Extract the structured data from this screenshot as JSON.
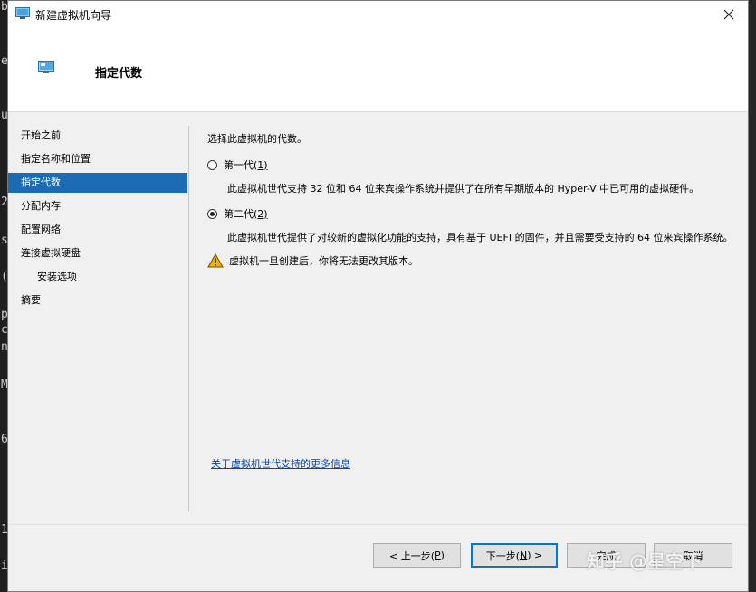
{
  "window": {
    "title": "新建虚拟机向导",
    "header_title": "指定代数"
  },
  "nav": {
    "items": [
      {
        "label": "开始之前"
      },
      {
        "label": "指定名称和位置"
      },
      {
        "label": "指定代数",
        "active": true
      },
      {
        "label": "分配内存"
      },
      {
        "label": "配置网络"
      },
      {
        "label": "连接虚拟硬盘"
      },
      {
        "label": "安装选项",
        "sub": true
      },
      {
        "label": "摘要"
      }
    ]
  },
  "content": {
    "instruction": "选择此虚拟机的代数。",
    "gen1": {
      "label": "第一代",
      "accel": "(1)",
      "selected": false,
      "description": "此虚拟机世代支持 32 位和 64 位来宾操作系统并提供了在所有早期版本的 Hyper-V 中已可用的虚拟硬件。"
    },
    "gen2": {
      "label": "第二代",
      "accel": "(2)",
      "selected": true,
      "description": "此虚拟机世代提供了对较新的虚拟化功能的支持，具有基于 UEFI 的固件，并且需要受支持的 64 位来宾操作系统。"
    },
    "warning": "虚拟机一旦创建后，你将无法更改其版本。",
    "more_link": "关于虚拟机世代支持的更多信息"
  },
  "buttons": {
    "back": {
      "prefix": "< 上一步(",
      "key": "P",
      "suffix": ")"
    },
    "next": {
      "prefix": "下一步(",
      "key": "N",
      "suffix": ") >"
    },
    "finish": "完成",
    "cancel": "取消"
  },
  "watermark": "知乎 @星空下",
  "terminal_chars": [
    "b",
    "e",
    "u",
    "2",
    "s",
    "(",
    "p",
    "c",
    "n",
    "M",
    "6",
    "1",
    "i"
  ],
  "colors": {
    "accent": "#1c6cb5",
    "link": "#0645ad",
    "warning": "#f2b200"
  }
}
